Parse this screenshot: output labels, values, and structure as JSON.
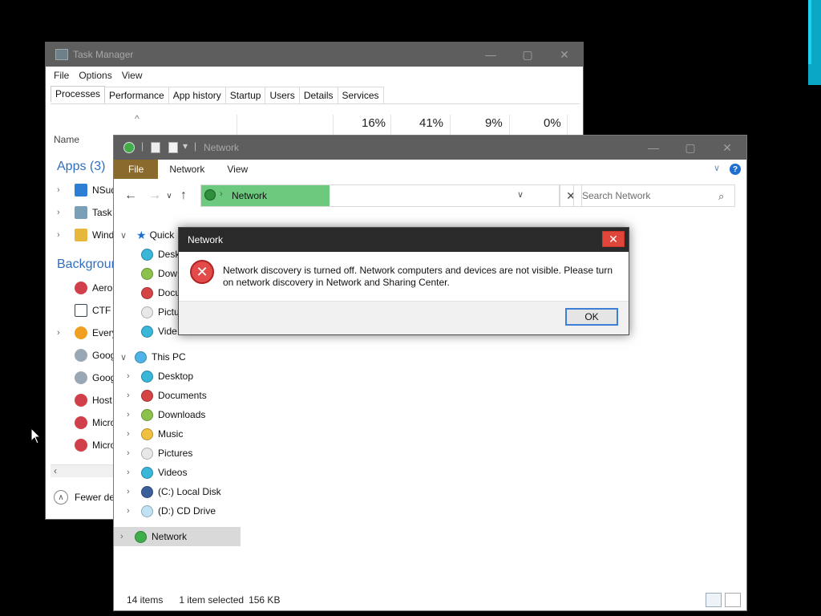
{
  "task_manager": {
    "title": "Task Manager",
    "menu": [
      "File",
      "Options",
      "View"
    ],
    "tabs": [
      "Processes",
      "Performance",
      "App history",
      "Startup",
      "Users",
      "Details",
      "Services"
    ],
    "column_sort_indicator": "^",
    "name_header": "Name",
    "usage": [
      "16%",
      "41%",
      "9%",
      "0%"
    ],
    "sections": {
      "apps": "Apps (3)",
      "background": "Backgroun"
    },
    "apps": [
      "NSud",
      "Task M",
      "Wind"
    ],
    "background": [
      "Aero",
      "CTF L",
      "Every",
      "Goog",
      "Goog",
      "Host",
      "Micro",
      "Micro"
    ],
    "footer": "Fewer de"
  },
  "explorer": {
    "title": "Network",
    "ribbon_tabs": [
      "File",
      "Network",
      "View"
    ],
    "address": "Network",
    "search_placeholder": "Search Network",
    "nav": {
      "quick_access": "Quick",
      "quick_items": [
        "Desk",
        "Dow",
        "Docu",
        "Pictu",
        "Vide"
      ],
      "this_pc": "This PC",
      "pc_items": [
        "Desktop",
        "Documents",
        "Downloads",
        "Music",
        "Pictures",
        "Videos",
        "(C:) Local Disk",
        "(D:) CD Drive"
      ],
      "network": "Network"
    },
    "status": {
      "items": "14 items",
      "selected": "1 item selected",
      "size": "156 KB"
    }
  },
  "dialog": {
    "title": "Network",
    "message": "Network discovery is turned off. Network computers and devices are not visible. Please turn on network discovery in Network and Sharing Center.",
    "ok": "OK"
  },
  "colors": {
    "titlebar": "#5e5e5e",
    "file_tab": "#8b6a2e",
    "address_highlight": "#6cc97d",
    "close_red": "#e0453a",
    "link_blue": "#2f6fbf"
  }
}
